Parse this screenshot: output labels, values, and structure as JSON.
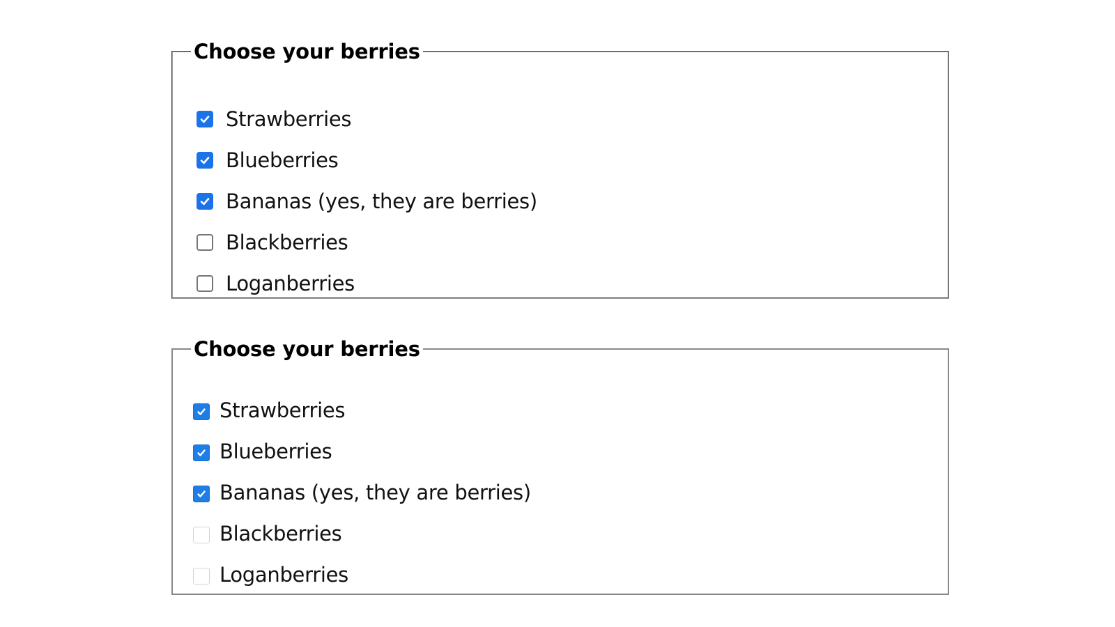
{
  "groups": [
    {
      "legend": "Choose your berries",
      "style": "filled",
      "options": [
        {
          "label": "Strawberries",
          "checked": true
        },
        {
          "label": "Blueberries",
          "checked": true
        },
        {
          "label": "Bananas (yes, they are berries)",
          "checked": true
        },
        {
          "label": "Blackberries",
          "checked": false
        },
        {
          "label": "Loganberries",
          "checked": false
        }
      ]
    },
    {
      "legend": "Choose your berries",
      "style": "flat",
      "options": [
        {
          "label": "Strawberries",
          "checked": true
        },
        {
          "label": "Blueberries",
          "checked": true
        },
        {
          "label": "Bananas (yes, they are berries)",
          "checked": true
        },
        {
          "label": "Blackberries",
          "checked": false
        },
        {
          "label": "Loganberries",
          "checked": false
        }
      ]
    }
  ],
  "colors": {
    "accent": "#1a73e8",
    "border": "#9a9a9a",
    "text": "#111111"
  }
}
